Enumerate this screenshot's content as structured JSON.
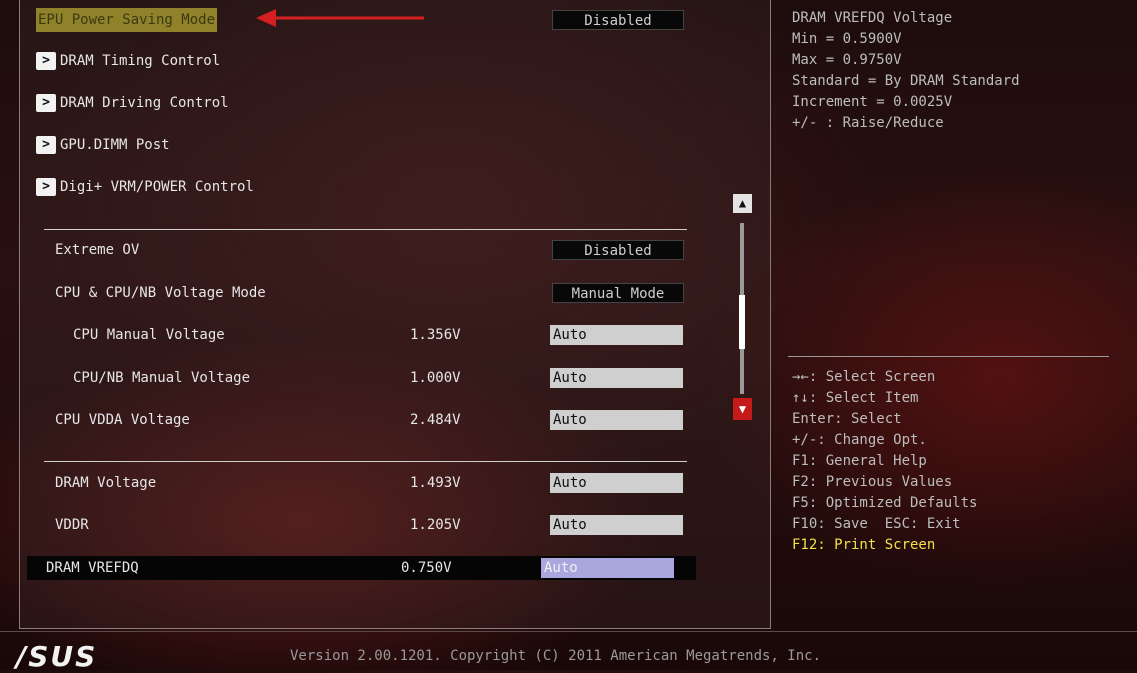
{
  "settings": {
    "epu": {
      "label": "EPU Power Saving Mode",
      "value": "Disabled"
    },
    "submenus": [
      "DRAM Timing Control",
      "DRAM Driving Control",
      "GPU.DIMM Post",
      "Digi+ VRM/POWER Control"
    ],
    "submenu_arrow": ">",
    "extreme_ov": {
      "label": "Extreme OV",
      "value": "Disabled"
    },
    "voltage_mode": {
      "label": "CPU & CPU/NB Voltage Mode",
      "value": "Manual Mode"
    },
    "cpu_manual": {
      "label": "CPU Manual Voltage",
      "current": "1.356V",
      "value": "Auto"
    },
    "cpunb_manual": {
      "label": "CPU/NB Manual Voltage",
      "current": "1.000V",
      "value": "Auto"
    },
    "vdda": {
      "label": "CPU VDDA Voltage",
      "current": "2.484V",
      "value": "Auto"
    },
    "dram_voltage": {
      "label": "DRAM Voltage",
      "current": "1.493V",
      "value": "Auto"
    },
    "vddr": {
      "label": "VDDR",
      "current": "1.205V",
      "value": "Auto"
    },
    "dram_vrefdq": {
      "label": "DRAM VREFDQ",
      "current": "0.750V",
      "value": "Auto"
    }
  },
  "help": {
    "text": "DRAM VREFDQ Voltage\nMin = 0.5900V\nMax = 0.9750V\nStandard = By DRAM Standard\nIncrement = 0.0025V\n+/- : Raise/Reduce"
  },
  "keys": {
    "select_screen": "→←: Select Screen",
    "select_item": "↑↓: Select Item",
    "enter": "Enter: Select",
    "change": "+/-: Change Opt.",
    "f1": "F1: General Help",
    "f2": "F2: Previous Values",
    "f5": "F5: Optimized Defaults",
    "f10": "F10: Save  ESC: Exit",
    "f12": "F12: Print Screen"
  },
  "scroll": {
    "up": "▲",
    "down": "▼"
  },
  "footer": {
    "logo": "/SUS",
    "version": "Version 2.00.1201. Copyright (C) 2011 American Megatrends, Inc."
  },
  "colors": {
    "accent_yellow": "#f2e24a",
    "selected_value": "#a9a7dd",
    "scroll_down": "#c41a1a",
    "arrow": "#d42020"
  }
}
